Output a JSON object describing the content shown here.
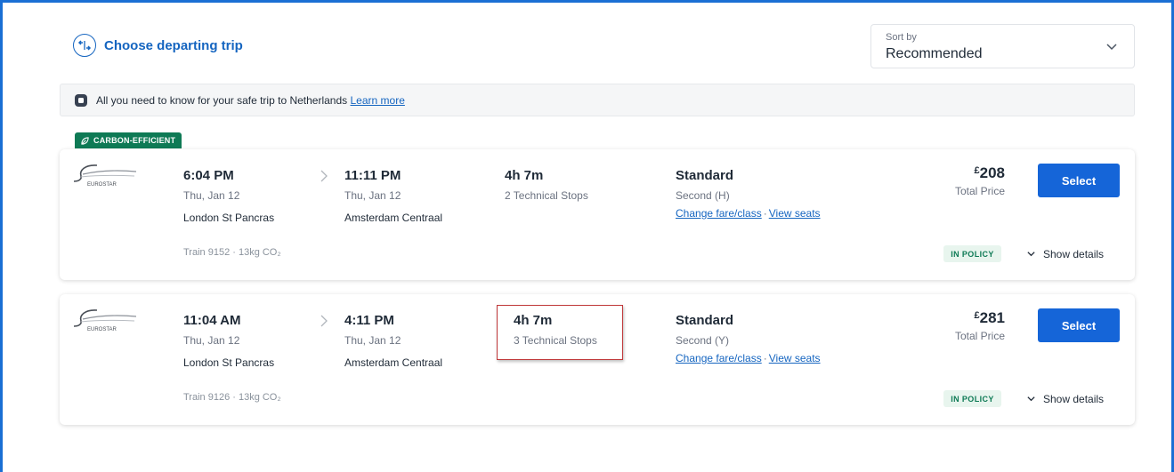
{
  "header": {
    "title": "Choose departing trip",
    "sort_label": "Sort by",
    "sort_value": "Recommended"
  },
  "banner": {
    "text": "All you need to know for your safe trip to Netherlands",
    "link": "Learn more"
  },
  "carbon_badge": "CARBON-EFFICIENT",
  "trips": [
    {
      "logo": "EUROSTAR",
      "dep_time": "6:04 PM",
      "dep_date": "Thu, Jan 12",
      "dep_station": "London St Pancras",
      "arr_time": "11:11 PM",
      "arr_date": "Thu, Jan 12",
      "arr_station": "Amsterdam Centraal",
      "duration": "4h 7m",
      "stops": "2 Technical Stops",
      "fare": "Standard",
      "fare_class": "Second (H)",
      "change_link": "Change fare/class",
      "seats_link": "View seats",
      "currency": "£",
      "price": "208",
      "price_label": "Total Price",
      "select_label": "Select",
      "train_info": "Train 9152 · 13kg CO₂",
      "policy": "IN POLICY",
      "details_label": "Show details"
    },
    {
      "logo": "EUROSTAR",
      "dep_time": "11:04 AM",
      "dep_date": "Thu, Jan 12",
      "dep_station": "London St Pancras",
      "arr_time": "4:11 PM",
      "arr_date": "Thu, Jan 12",
      "arr_station": "Amsterdam Centraal",
      "duration": "4h 7m",
      "stops": "3 Technical Stops",
      "fare": "Standard",
      "fare_class": "Second (Y)",
      "change_link": "Change fare/class",
      "seats_link": "View seats",
      "currency": "£",
      "price": "281",
      "price_label": "Total Price",
      "select_label": "Select",
      "train_info": "Train 9126 · 13kg CO₂",
      "policy": "IN POLICY",
      "details_label": "Show details"
    }
  ],
  "colors": {
    "accent": "#1565d8",
    "carbon_green": "#0e7a55",
    "highlight": "#c0393b",
    "frame": "#1a6fd4"
  }
}
